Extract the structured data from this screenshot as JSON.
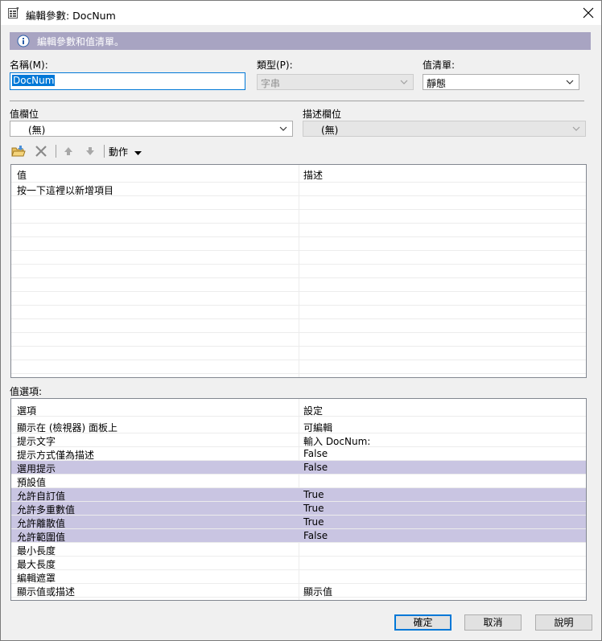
{
  "window": {
    "title": "編輯參數: DocNum"
  },
  "info": {
    "text": "編輯參數和值清單。"
  },
  "name": {
    "label": "名稱(M):",
    "value": "DocNum"
  },
  "type": {
    "label": "類型(P):",
    "value": "字串"
  },
  "value_list": {
    "label": "值清單:",
    "value": "靜態"
  },
  "value_field": {
    "label": "值欄位",
    "value": "(無)"
  },
  "desc_field": {
    "label": "描述欄位",
    "value": "(無)"
  },
  "toolbar": {
    "action_label": "動作"
  },
  "values_table": {
    "headers": [
      "值",
      "描述"
    ],
    "placeholder": "按一下這裡以新增項目"
  },
  "options": {
    "label": "值選項:",
    "headers": [
      "選項",
      "設定"
    ],
    "rows": [
      {
        "option": "顯示在 (檢視器) 面板上",
        "setting": "可編輯",
        "highlight": false
      },
      {
        "option": "提示文字",
        "setting": "輸入 DocNum:",
        "highlight": false
      },
      {
        "option": "提示方式僅為描述",
        "setting": "False",
        "highlight": false
      },
      {
        "option": "選用提示",
        "setting": "False",
        "highlight": true
      },
      {
        "option": "預設值",
        "setting": "",
        "highlight": false
      },
      {
        "option": "允許自訂值",
        "setting": "True",
        "highlight": true
      },
      {
        "option": "允許多重數值",
        "setting": "True",
        "highlight": true
      },
      {
        "option": "允許離散值",
        "setting": "True",
        "highlight": true
      },
      {
        "option": "允許範圍值",
        "setting": "False",
        "highlight": true
      },
      {
        "option": "最小長度",
        "setting": "",
        "highlight": false
      },
      {
        "option": "最大長度",
        "setting": "",
        "highlight": false
      },
      {
        "option": "編輯遮罩",
        "setting": "",
        "highlight": false
      },
      {
        "option": "顯示值或描述",
        "setting": "顯示值",
        "highlight": false
      }
    ]
  },
  "buttons": {
    "ok": "確定",
    "cancel": "取消",
    "help": "說明"
  },
  "colors": {
    "accent": "#0078d7",
    "info_bar": "#a8a4c2",
    "row_highlight": "#c9c5e2"
  }
}
